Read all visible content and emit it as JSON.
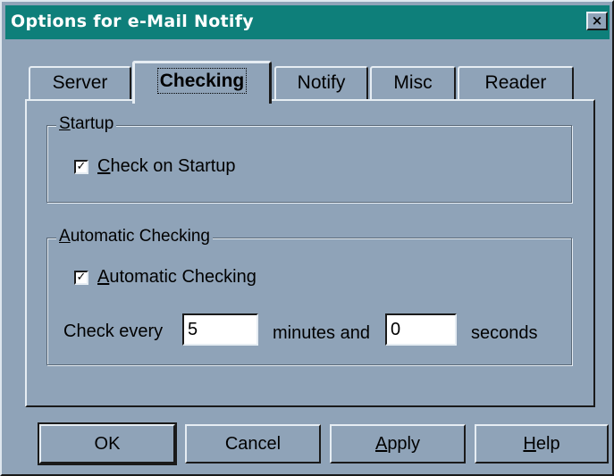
{
  "window": {
    "title": "Options for e-Mail Notify",
    "close_label": "×"
  },
  "tabs": [
    {
      "label": "Server",
      "active": false
    },
    {
      "label": "Checking",
      "active": true
    },
    {
      "label": "Notify",
      "active": false
    },
    {
      "label": "Misc",
      "active": false
    },
    {
      "label": "Reader",
      "active": false
    }
  ],
  "startup": {
    "group_title_first": "S",
    "group_title_rest": "tartup",
    "checkbox_label_first": "C",
    "checkbox_label_rest": "heck on Startup",
    "checked": true,
    "check_mark": "✓"
  },
  "automatic": {
    "group_title_first": "A",
    "group_title_rest": "utomatic Checking",
    "checkbox_label_first": "A",
    "checkbox_label_rest": "utomatic Checking",
    "checked": true,
    "check_mark": "✓",
    "check_every_label": "Check every",
    "minutes_value": "5",
    "minutes_label": "minutes and",
    "seconds_value": "0",
    "seconds_label": "seconds"
  },
  "buttons": {
    "ok": "OK",
    "cancel": "Cancel",
    "apply_first": "A",
    "apply_rest": "pply",
    "help_first": "H",
    "help_rest": "elp"
  },
  "colors": {
    "titlebar": "#0e7f7a",
    "face": "#8fa3b8"
  }
}
